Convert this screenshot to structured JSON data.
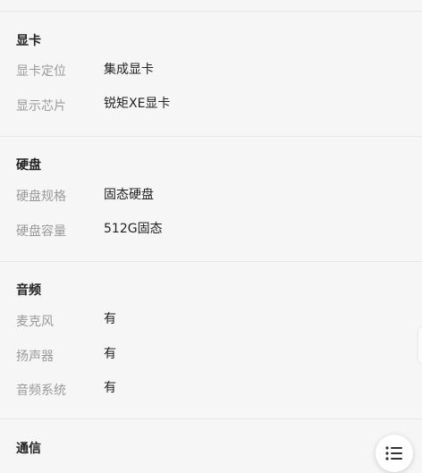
{
  "sections": [
    {
      "title": "显卡",
      "rows": [
        {
          "label": "显卡定位",
          "value": "集成显卡"
        },
        {
          "label": "显示芯片",
          "value": "锐矩XE显卡"
        }
      ]
    },
    {
      "title": "硬盘",
      "rows": [
        {
          "label": "硬盘规格",
          "value": "固态硬盘"
        },
        {
          "label": "硬盘容量",
          "value": "512G固态"
        }
      ]
    },
    {
      "title": "音频",
      "rows": [
        {
          "label": "麦克风",
          "value": "有"
        },
        {
          "label": "扬声器",
          "value": "有"
        },
        {
          "label": "音频系统",
          "value": "有"
        }
      ]
    },
    {
      "title": "通信",
      "rows": []
    }
  ],
  "floating_button": {
    "icon": "list-menu-icon"
  }
}
